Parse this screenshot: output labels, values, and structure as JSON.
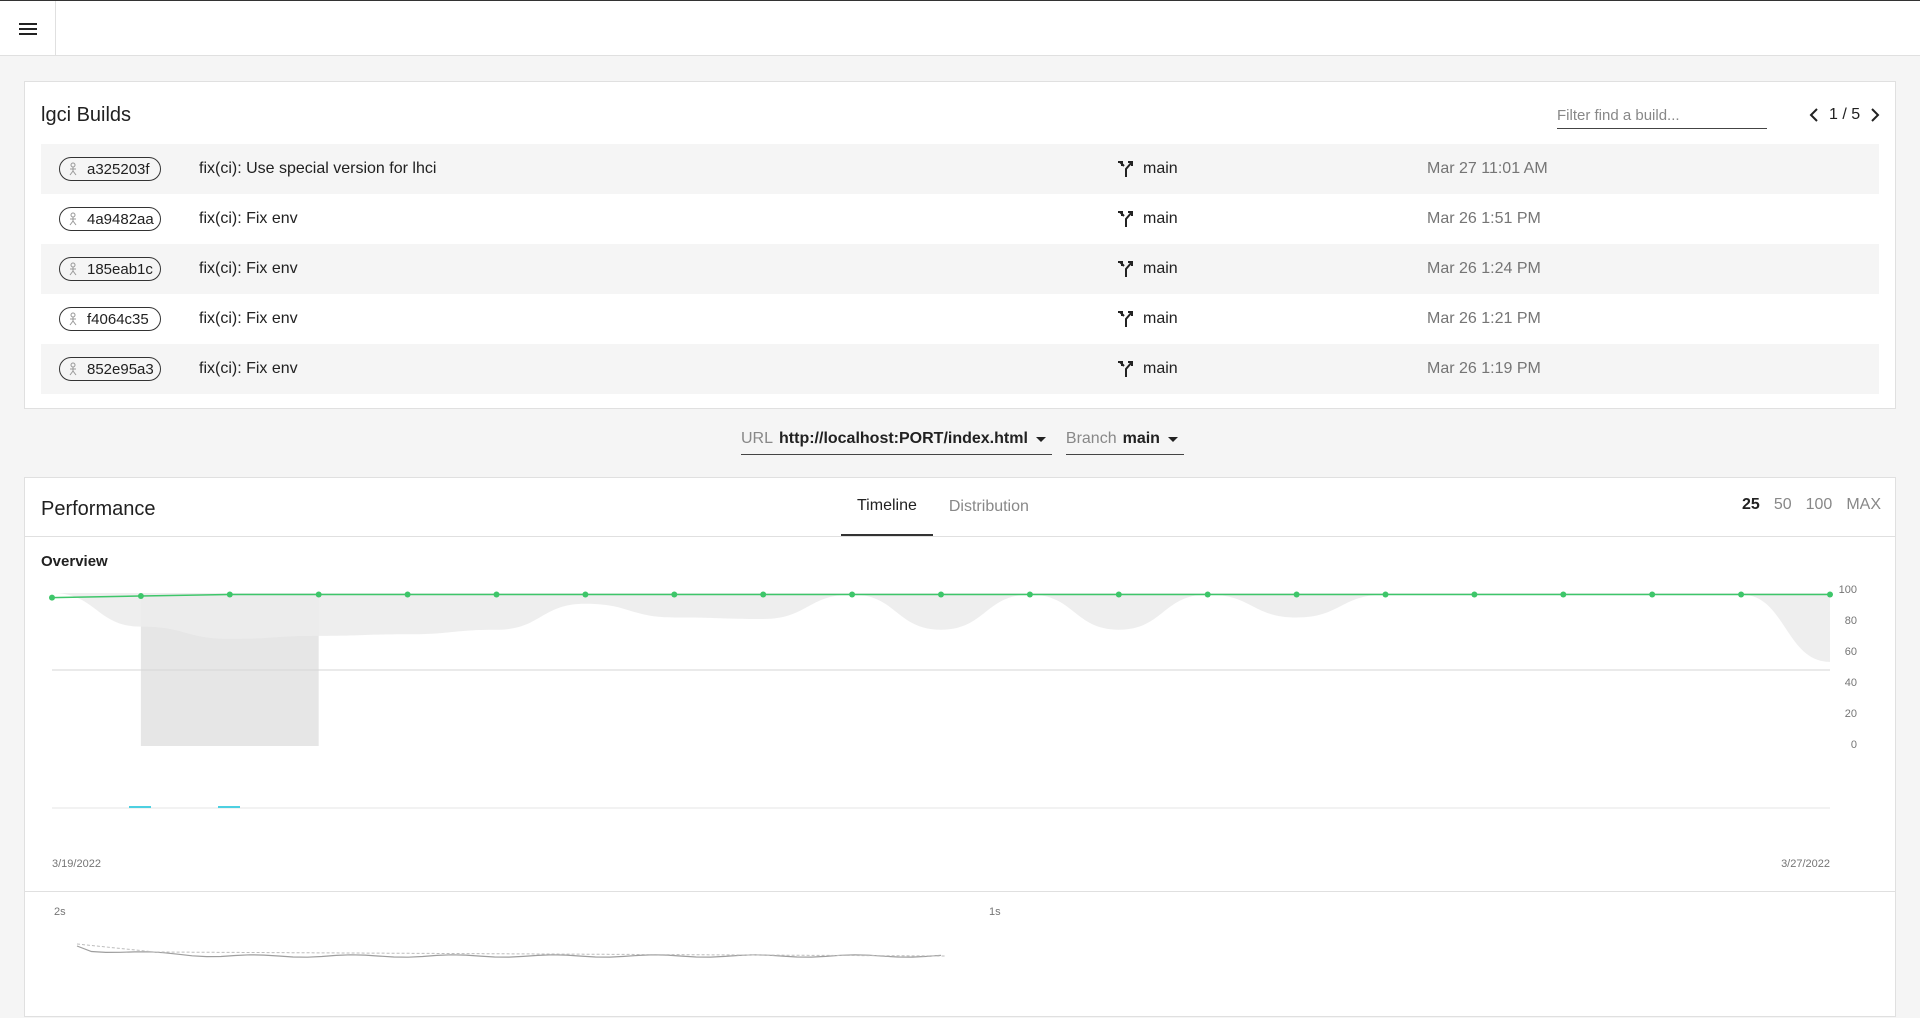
{
  "builds": {
    "title": "lgci Builds",
    "filter_placeholder": "Filter find a build...",
    "pager": "1 / 5",
    "rows": [
      {
        "hash": "a325203f",
        "message": "fix(ci): Use special version for lhci",
        "branch": "main",
        "time": "Mar 27 11:01 AM"
      },
      {
        "hash": "4a9482aa",
        "message": "fix(ci): Fix env",
        "branch": "main",
        "time": "Mar 26 1:51 PM"
      },
      {
        "hash": "185eab1c",
        "message": "fix(ci): Fix env",
        "branch": "main",
        "time": "Mar 26 1:24 PM"
      },
      {
        "hash": "f4064c35",
        "message": "fix(ci): Fix env",
        "branch": "main",
        "time": "Mar 26 1:21 PM"
      },
      {
        "hash": "852e95a3",
        "message": "fix(ci): Fix env",
        "branch": "main",
        "time": "Mar 26 1:19 PM"
      }
    ]
  },
  "selectors": {
    "url_label": "URL",
    "url_value": "http://localhost:PORT/index.html",
    "branch_label": "Branch",
    "branch_value": "main"
  },
  "performance": {
    "title": "Performance",
    "tabs": [
      "Timeline",
      "Distribution"
    ],
    "ranges": [
      "25",
      "50",
      "100",
      "MAX"
    ],
    "overview_label": "Overview",
    "start_date": "3/19/2022",
    "end_date": "3/27/2022",
    "lower_labels": [
      "2s",
      "1s"
    ]
  },
  "colors": {
    "score_line": "#3ec66a",
    "band": "#e8e8e8",
    "accent_bar": "#4dd0e1"
  },
  "chart_data": {
    "type": "line",
    "title": "Overview",
    "ylim": [
      0,
      100
    ],
    "yticks": [
      "100",
      "80",
      "60",
      "40",
      "20",
      "0"
    ],
    "x_start_label": "3/19/2022",
    "x_end_label": "3/27/2022",
    "series": [
      {
        "values": [
          97,
          98,
          99,
          99,
          99,
          99,
          99,
          99,
          99,
          99,
          99,
          99,
          99,
          99,
          99,
          99,
          99,
          99,
          99,
          99,
          99
        ]
      }
    ],
    "lower_band": [
      100,
      78,
      70,
      72,
      73,
      76,
      93,
      84,
      83,
      99,
      76,
      99,
      76,
      99,
      84,
      99,
      99,
      99,
      99,
      99,
      55
    ],
    "grid": true
  }
}
